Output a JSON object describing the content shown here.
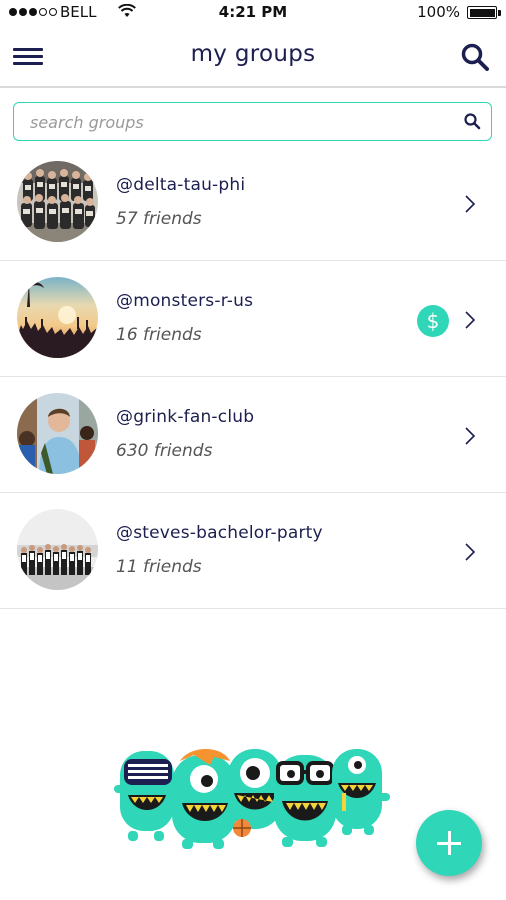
{
  "status_bar": {
    "carrier": "BELL",
    "time": "4:21 PM",
    "battery": "100%",
    "signal_strength": 3,
    "signal_max": 5
  },
  "nav": {
    "title": "my groups",
    "menu_icon": "hamburger-menu-icon",
    "search_icon": "search-icon"
  },
  "search": {
    "placeholder": "search groups",
    "value": ""
  },
  "groups": [
    {
      "handle": "@delta-tau-phi",
      "friends": "57 friends",
      "has_payment": false
    },
    {
      "handle": "@monsters-r-us",
      "friends": "16 friends",
      "has_payment": true,
      "payment_symbol": "$"
    },
    {
      "handle": "@grink-fan-club",
      "friends": "630 friends",
      "has_payment": false
    },
    {
      "handle": "@steves-bachelor-party",
      "friends": "11 friends",
      "has_payment": false
    }
  ],
  "colors": {
    "accent": "#2fd6b8",
    "text_dark": "#1c1f4f",
    "monster_green": "#2fd6b8"
  }
}
